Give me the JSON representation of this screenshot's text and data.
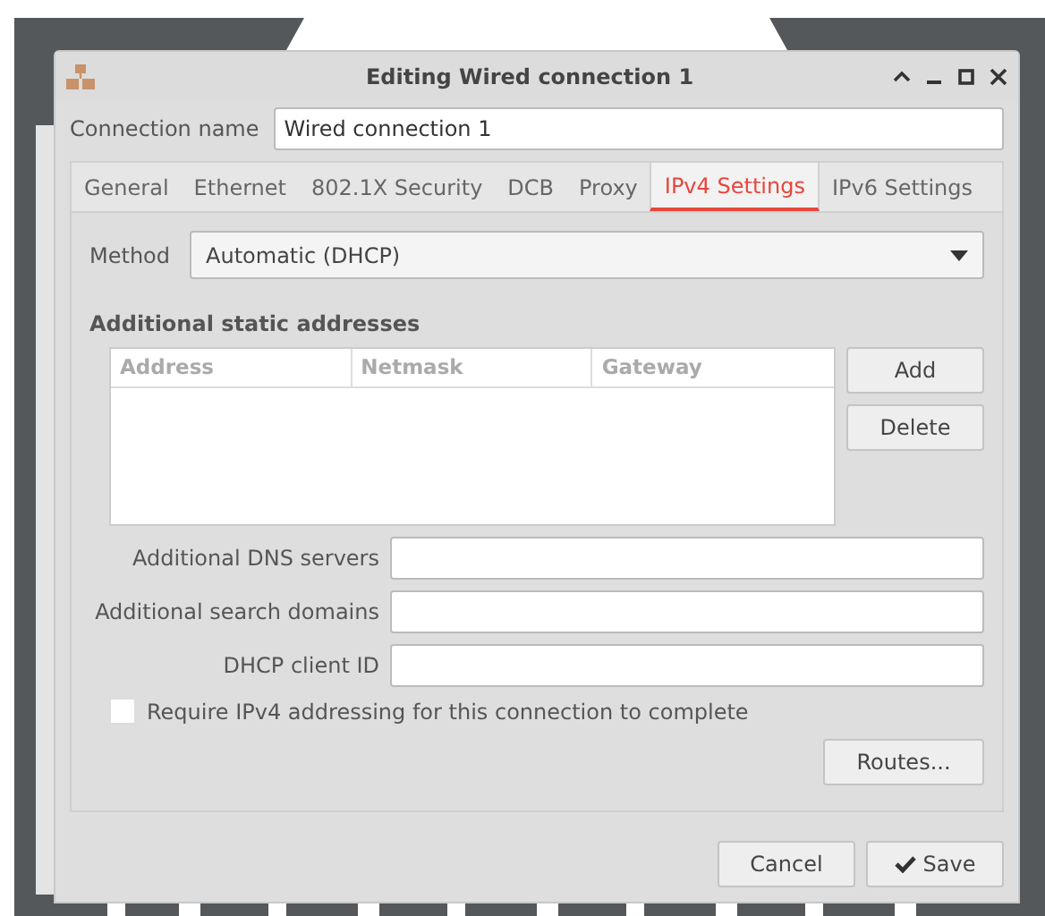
{
  "window": {
    "title": "Editing Wired connection 1"
  },
  "connection_name": {
    "label": "Connection name",
    "value": "Wired connection 1"
  },
  "tabs": [
    {
      "label": "General",
      "selected": false
    },
    {
      "label": "Ethernet",
      "selected": false
    },
    {
      "label": "802.1X Security",
      "selected": false
    },
    {
      "label": "DCB",
      "selected": false
    },
    {
      "label": "Proxy",
      "selected": false
    },
    {
      "label": "IPv4 Settings",
      "selected": true
    },
    {
      "label": "IPv6 Settings",
      "selected": false
    }
  ],
  "method": {
    "label": "Method",
    "value": "Automatic (DHCP)"
  },
  "addresses": {
    "heading": "Additional static addresses",
    "columns": [
      "Address",
      "Netmask",
      "Gateway"
    ],
    "buttons": [
      "Add",
      "Delete"
    ]
  },
  "fields": [
    {
      "label": "Additional DNS servers"
    },
    {
      "label": "Additional search domains"
    },
    {
      "label": "DHCP client ID"
    }
  ],
  "require": {
    "label": "Require IPv4 addressing for this connection to complete",
    "checked": false
  },
  "routes_button": "Routes...",
  "buttons": [
    "Cancel",
    "Save"
  ]
}
